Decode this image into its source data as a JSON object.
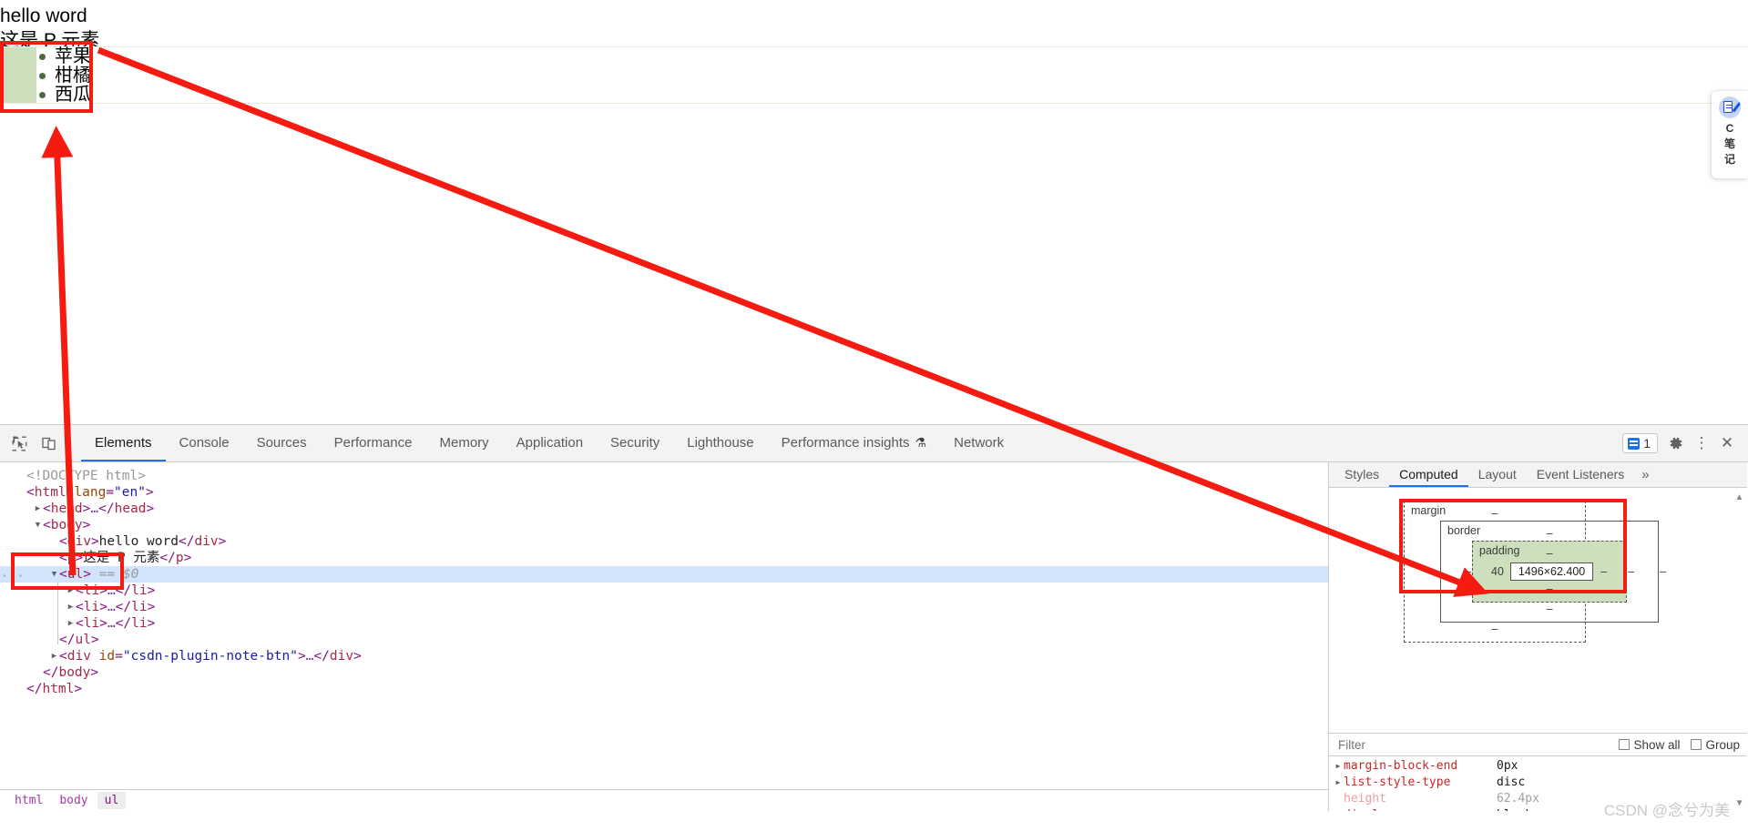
{
  "page": {
    "div_text": "hello word",
    "p_text": "这是 P 元素",
    "list_items": [
      "苹果",
      "柑橘",
      "西瓜"
    ]
  },
  "csdn_widget": {
    "icon": "note-pen-icon",
    "line1": "C",
    "line2": "笔",
    "line3": "记"
  },
  "devtools": {
    "toolbar": {
      "inspect_icon": "inspect-element-icon",
      "device_icon": "device-toolbar-icon",
      "tabs": [
        {
          "label": "Elements",
          "active": true
        },
        {
          "label": "Console",
          "active": false
        },
        {
          "label": "Sources",
          "active": false
        },
        {
          "label": "Performance",
          "active": false
        },
        {
          "label": "Memory",
          "active": false
        },
        {
          "label": "Application",
          "active": false
        },
        {
          "label": "Security",
          "active": false
        },
        {
          "label": "Lighthouse",
          "active": false
        },
        {
          "label": "Performance insights",
          "active": false,
          "badge": "flask"
        },
        {
          "label": "Network",
          "active": false
        }
      ],
      "message_count": "1",
      "settings_icon": "gear-icon",
      "more_icon": "kebab-menu-icon",
      "close_icon": "close-icon"
    },
    "dom_tree": [
      {
        "indent": 0,
        "twisty": "",
        "kind": "doctype",
        "text": "<!DOCTYPE html>"
      },
      {
        "indent": 0,
        "twisty": "",
        "kind": "open",
        "tag": "html",
        "attr_name": "lang",
        "attr_value": "\"en\""
      },
      {
        "indent": 1,
        "twisty": "▶",
        "kind": "collapsed",
        "tag": "head"
      },
      {
        "indent": 1,
        "twisty": "▼",
        "kind": "open",
        "tag": "body"
      },
      {
        "indent": 2,
        "twisty": "",
        "kind": "inline",
        "tag": "div",
        "text": "hello word"
      },
      {
        "indent": 2,
        "twisty": "",
        "kind": "inline",
        "tag": "p",
        "text": "这是 P 元素"
      },
      {
        "indent": 2,
        "twisty": "▼",
        "kind": "selected",
        "tag": "ul",
        "ref": "== $0"
      },
      {
        "indent": 3,
        "twisty": "▶",
        "kind": "collapsed",
        "tag": "li"
      },
      {
        "indent": 3,
        "twisty": "▶",
        "kind": "collapsed",
        "tag": "li"
      },
      {
        "indent": 3,
        "twisty": "▶",
        "kind": "collapsed",
        "tag": "li"
      },
      {
        "indent": 2,
        "twisty": "",
        "kind": "close",
        "tag": "ul"
      },
      {
        "indent": 2,
        "twisty": "▶",
        "kind": "collapsed-attr",
        "tag": "div",
        "attr_name": "id",
        "attr_value": "\"csdn-plugin-note-btn\""
      },
      {
        "indent": 1,
        "twisty": "",
        "kind": "close",
        "tag": "body"
      },
      {
        "indent": 0,
        "twisty": "",
        "kind": "close",
        "tag": "html"
      }
    ],
    "breadcrumbs": [
      {
        "label": "html",
        "active": false
      },
      {
        "label": "body",
        "active": false
      },
      {
        "label": "ul",
        "active": true
      }
    ],
    "side_tabs": [
      {
        "label": "Styles",
        "active": false
      },
      {
        "label": "Computed",
        "active": true
      },
      {
        "label": "Layout",
        "active": false
      },
      {
        "label": "Event Listeners",
        "active": false
      }
    ],
    "side_more": "»",
    "box_model": {
      "margin_label": "margin",
      "margin_top": "–",
      "margin_right": "–",
      "margin_bottom": "–",
      "margin_left": "–",
      "border_label": "border",
      "border_top": "–",
      "border_right": "–",
      "border_bottom": "–",
      "border_left": "–",
      "padding_label": "padding",
      "padding_top": "–",
      "padding_right": "–",
      "padding_bottom": "–",
      "padding_left": "40",
      "content_size": "1496×62.400",
      "padding_color": "#cedfbd"
    },
    "filter": {
      "placeholder": "Filter",
      "value": "",
      "show_all_label": "Show all",
      "show_all_checked": false,
      "group_label": "Group",
      "group_checked": false
    },
    "computed_properties": [
      {
        "twisty": "▶",
        "name": "display",
        "value": "block",
        "inherited": false
      },
      {
        "twisty": "",
        "name": "height",
        "value": "62.4px",
        "inherited": true
      },
      {
        "twisty": "▶",
        "name": "list-style-type",
        "value": "disc",
        "inherited": false
      },
      {
        "twisty": "▶",
        "name": "margin-block-end",
        "value": "0px",
        "inherited": false
      }
    ]
  },
  "watermark": "CSDN @念兮为美",
  "annotations": {
    "color": "#f51b10",
    "boxes": [
      {
        "name": "page-list-highlight-box"
      },
      {
        "name": "dom-ul-node-box"
      },
      {
        "name": "box-model-box"
      }
    ],
    "arrows": [
      {
        "name": "dom-to-page-arrow"
      },
      {
        "name": "page-to-boxmodel-arrow"
      }
    ]
  }
}
